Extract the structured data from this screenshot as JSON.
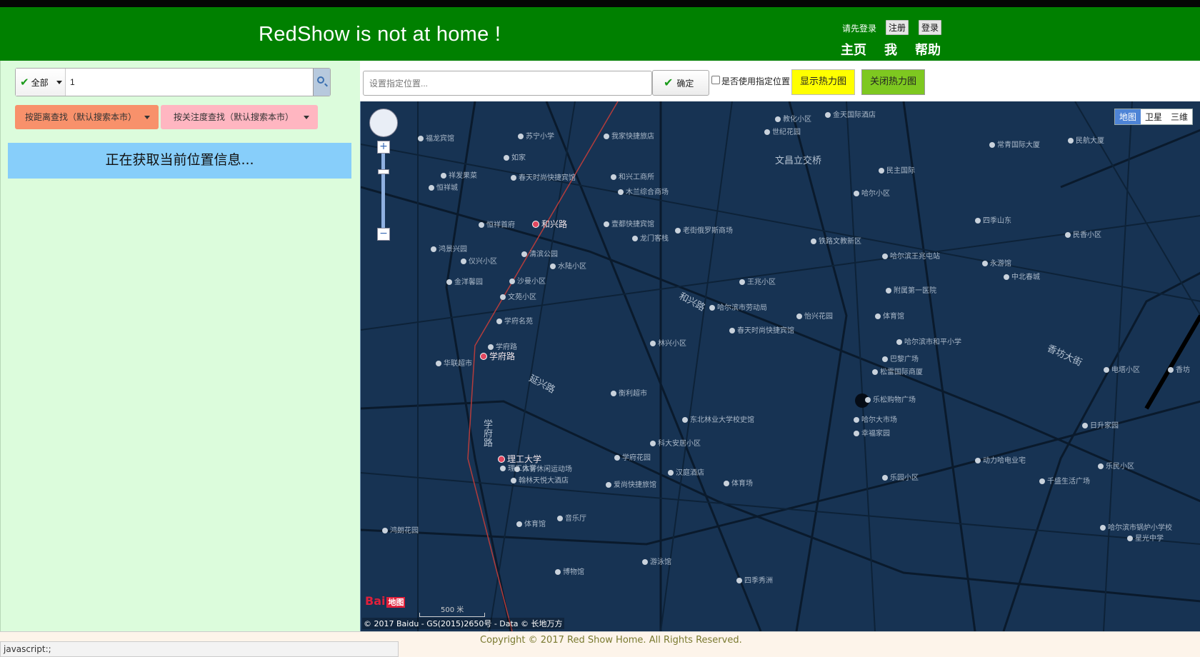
{
  "header": {
    "title": "RedShow is not at home !",
    "login_prompt": "请先登录",
    "register": "注册",
    "login": "登录",
    "nav": [
      "主页",
      "我",
      "帮助"
    ]
  },
  "sidebar": {
    "scope_select": "全部",
    "search_value": "1",
    "sort_distance": "按距离查找（默认搜索本市）",
    "sort_attention": "按关注度查找（默认搜索本市）",
    "location_status": "正在获取当前位置信息..."
  },
  "map_toolbar": {
    "addr_placeholder": "设置指定位置...",
    "confirm": "确定",
    "use_location_label": "是否使用指定位置",
    "show_heat": "显示热力图",
    "close_heat": "关闭热力图"
  },
  "map": {
    "types": [
      "地图",
      "卫星",
      "三维"
    ],
    "active_type": "地图",
    "zoom_in": "+",
    "zoom_out": "−",
    "logo": "Bai",
    "logo_tag": "地图",
    "scale": "500 米",
    "copyright": "© 2017 Baidu - GS(2015)2650号 - Data © 长地万方",
    "roads": [
      {
        "name": "和兴路"
      },
      {
        "name": "延兴路"
      },
      {
        "name": "学府路"
      },
      {
        "name": "香坊大街"
      },
      {
        "name": "文昌立交桥"
      }
    ],
    "metro": [
      {
        "name": "和兴路"
      },
      {
        "name": "学府路"
      },
      {
        "name": "理工大学"
      }
    ],
    "pois": [
      "福龙宾馆",
      "苏宁小学",
      "我家快捷旅店",
      "教化小区",
      "金天国际酒店",
      "世纪花园",
      "如家",
      "和兴工商所",
      "祥发果菜",
      "恒祥城",
      "春天时尚快捷宾馆",
      "木兰综合商场",
      "民主国际",
      "哈尔小区",
      "常青国际大厦",
      "民航大厦",
      "恒祥首府",
      "壹都快捷宾馆",
      "老街俄罗斯商场",
      "龙门客栈",
      "四季山东",
      "民香小区",
      "鸿景兴园",
      "清滨公园",
      "仪兴小区",
      "水陆小区",
      "铁路文教新区",
      "哈尔滨王兆屯站",
      "永游馆",
      "中北春城",
      "沙曼小区",
      "金洋馨园",
      "文苑小区",
      "王兆小区",
      "附属第一医院",
      "学府名苑",
      "哈尔滨市劳动局",
      "怡兴花园",
      "体育馆",
      "学府路",
      "华联超市",
      "林兴小区",
      "春天时尚快捷宾馆",
      "哈尔滨市和平小学",
      "巴黎广场",
      "松雷国际商厦",
      "电塔小区",
      "香坊",
      "衡利超市",
      "乐松购物广场",
      "东北林业大学校史馆",
      "哈尔大市场",
      "日升家园",
      "幸福家园",
      "科大安居小区",
      "理工大学",
      "学府花园",
      "体育休闲运动场",
      "翰林天悦大酒店",
      "汉庭酒店",
      "爱尚快捷旅馆",
      "体育场",
      "动力哈电业宅",
      "千盛生活广场",
      "乐民小区",
      "乐园小区",
      "体育馆",
      "音乐厅",
      "鸿朗花园",
      "游泳馆",
      "博物馆",
      "四季秀洲",
      "哈尔滨市锅炉小学校",
      "星光中学"
    ]
  },
  "footer": {
    "copyright": "Copyright © 2017 Red Show Home. All Rights Reserved.",
    "status": "javascript:;"
  }
}
